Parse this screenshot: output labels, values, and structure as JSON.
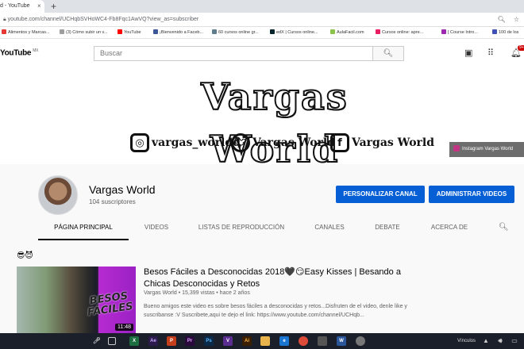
{
  "browser": {
    "tab_title": "d - YouTube",
    "tab_close": "×",
    "new_tab": "+",
    "url": "youtube.com/channel/UCHqbSVHoWC4-Fb8Fqc1AwVQ?view_as=subscriber",
    "bookmarks": [
      {
        "label": "Alimentos y Marcas...",
        "color": "#e53935"
      },
      {
        "label": "(3) Cómo subir un v...",
        "color": "#9e9e9e"
      },
      {
        "label": "YouTube",
        "color": "#ff0000"
      },
      {
        "label": "¡Bienvenido a Faceb...",
        "color": "#3b5998"
      },
      {
        "label": "60 cursos online gr...",
        "color": "#607d8b"
      },
      {
        "label": "edX | Cursos online...",
        "color": "#02262b"
      },
      {
        "label": "AulaFacil.com",
        "color": "#8bc34a"
      },
      {
        "label": "Cursos online: apre...",
        "color": "#e91e63"
      },
      {
        "label": "[ Course Intro...",
        "color": "#9c27b0"
      },
      {
        "label": "100 de los",
        "color": "#3f51b5"
      }
    ]
  },
  "header": {
    "logo": "YouTube",
    "region": "MX",
    "search_placeholder": "Buscar",
    "notification_count": "9+"
  },
  "banner": {
    "title": "Vargas World",
    "instagram_handle": "vargas_worldd",
    "twitter_name": "Vargas World",
    "facebook_name": "Vargas World",
    "link_label": "Instagram Vargas World"
  },
  "channel": {
    "name": "Vargas World",
    "subscribers": "104 suscriptores",
    "customize_button": "PERSONALIZAR CANAL",
    "manage_button": "ADMINISTRAR VIDEOS",
    "tabs": [
      "PÁGINA PRINCIPAL",
      "VIDEOS",
      "LISTAS DE REPRODUCCIÓN",
      "CANALES",
      "DEBATE",
      "ACERCA DE"
    ]
  },
  "featured": {
    "emojis": "😎😈",
    "thumbnail_text": "BESOS FÁCILES",
    "duration": "11:48",
    "title": "Besos Fáciles a Desconocidas 2018🖤😏Easy Kisses | Besando a Chicas Desconocidas y Retos",
    "meta": "Vargas World • 15,399 vistas • hace 2 años",
    "description": "Bueno amigos este video es sobre besos fáciles a desconocidas y retos...Disfruten de el video, denle like y suscribanse :V Suscribete,aqui te dejo el link: https://www.youtube.com/channel/UCHqb..."
  },
  "taskbar": {
    "tray_text": "Vínculos",
    "apps": [
      {
        "label": "X",
        "color": "#1d6f42"
      },
      {
        "label": "Ae",
        "color": "#2b1b4d"
      },
      {
        "label": "P",
        "color": "#c43e1c"
      },
      {
        "label": "Pr",
        "color": "#2a0a3d"
      },
      {
        "label": "Ps",
        "color": "#0b2a4a"
      },
      {
        "label": "V",
        "color": "#5c2d91"
      },
      {
        "label": "Ai",
        "color": "#3b1f00"
      },
      {
        "label": "",
        "color": "#e9b44c"
      },
      {
        "label": "e",
        "color": "#1a75d1"
      },
      {
        "label": "",
        "color": "#dd4b39"
      },
      {
        "label": "",
        "color": "#555555"
      },
      {
        "label": "W",
        "color": "#2b579a"
      },
      {
        "label": "",
        "color": "#777777"
      }
    ]
  }
}
